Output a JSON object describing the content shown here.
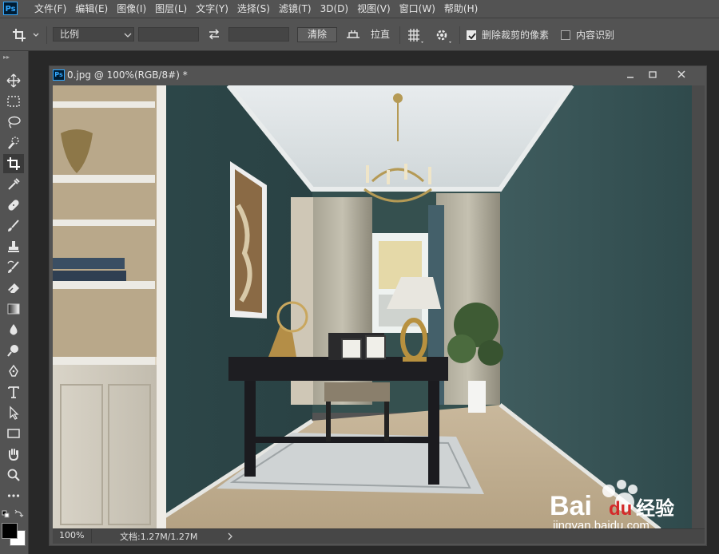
{
  "app": {
    "logo": "Ps"
  },
  "menu": [
    "文件(F)",
    "编辑(E)",
    "图像(I)",
    "图层(L)",
    "文字(Y)",
    "选择(S)",
    "滤镜(T)",
    "3D(D)",
    "视图(V)",
    "窗口(W)",
    "帮助(H)"
  ],
  "options": {
    "ratio_select": "比例",
    "width_value": "",
    "height_value": "",
    "clear_label": "清除",
    "straighten_label": "拉直",
    "delete_cropped": {
      "label": "删除裁剪的像素",
      "checked": true
    },
    "content_aware": {
      "label": "内容识别",
      "checked": false
    }
  },
  "document": {
    "title": "0.jpg @ 100%(RGB/8#) *",
    "zoom": "100%",
    "doc_info": "文档:1.27M/1.27M"
  },
  "watermark": {
    "brand": "Bai",
    "brand2": "du",
    "brand_cn": "经验",
    "url": "jingyan.baidu.com"
  },
  "tools": [
    "move-icon",
    "marquee-icon",
    "lasso-icon",
    "quick-select-icon",
    "crop-icon",
    "eyedropper-icon",
    "healing-icon",
    "brush-icon",
    "stamp-icon",
    "history-brush-icon",
    "eraser-icon",
    "gradient-icon",
    "blur-icon",
    "dodge-icon",
    "pen-icon",
    "type-icon",
    "path-select-icon",
    "rectangle-icon",
    "hand-icon",
    "zoom-icon",
    "more-icon"
  ],
  "colors": {
    "foreground": "#000000",
    "background": "#ffffff",
    "accent": "#31a8ff"
  }
}
